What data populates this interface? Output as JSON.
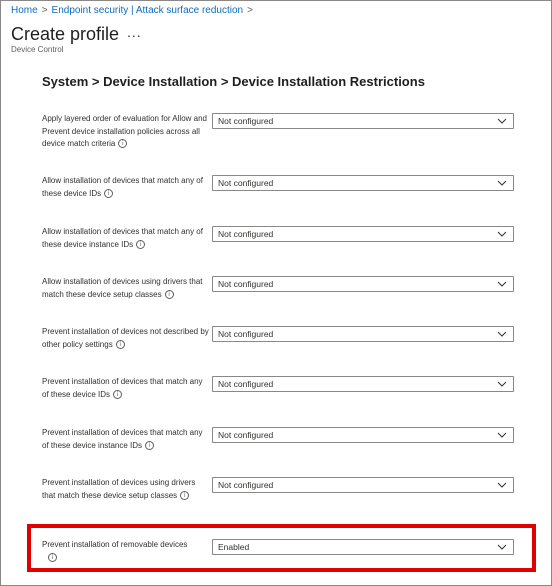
{
  "breadcrumb": {
    "items": [
      "Home",
      "Endpoint security | Attack surface reduction"
    ],
    "separator": ">"
  },
  "header": {
    "title": "Create profile",
    "more_label": "...",
    "subtitle": "Device Control"
  },
  "section_title": "System > Device Installation > Device Installation Restrictions",
  "settings": [
    {
      "label": "Apply layered order of evaluation for Allow and Prevent device installation policies across all device match criteria",
      "value": "Not configured"
    },
    {
      "label": "Allow installation of devices that match any of these device IDs",
      "value": "Not configured"
    },
    {
      "label": "Allow installation of devices that match any of these device instance IDs",
      "value": "Not configured"
    },
    {
      "label": "Allow installation of devices using drivers that match these device setup classes",
      "value": "Not configured"
    },
    {
      "label": "Prevent installation of devices not described by other policy settings",
      "value": "Not configured"
    },
    {
      "label": "Prevent installation of devices that match any of these device IDs",
      "value": "Not configured"
    },
    {
      "label": "Prevent installation of devices that match any of these device instance IDs",
      "value": "Not configured"
    },
    {
      "label": "Prevent installation of devices using drivers that match these device setup classes",
      "value": "Not configured"
    },
    {
      "label": "Prevent installation of removable devices",
      "value": "Enabled",
      "highlighted": true
    }
  ],
  "info_icon_glyph": "i",
  "colors": {
    "link": "#0f6cbd",
    "highlight": "#e00000",
    "border": "#8a8886"
  }
}
